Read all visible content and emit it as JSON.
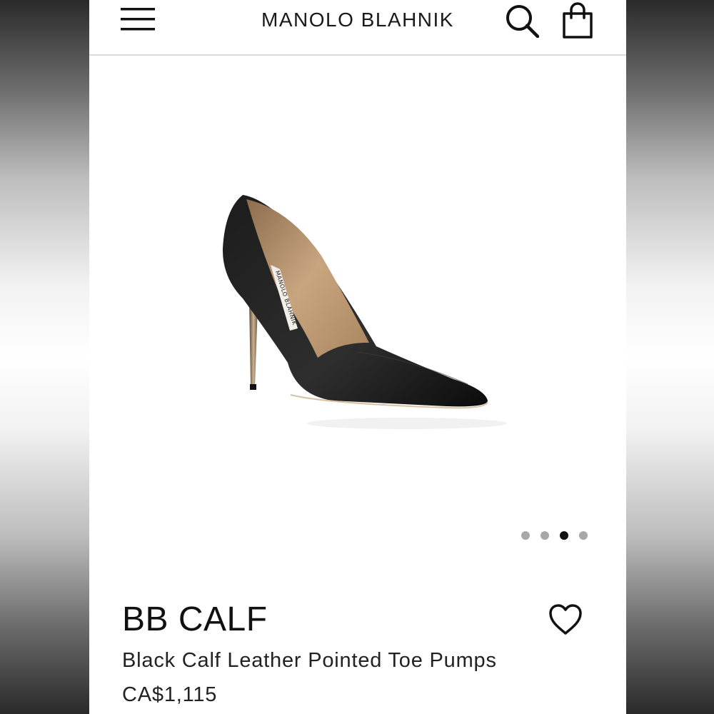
{
  "header": {
    "brand": "MANOLO BLAHNIK",
    "menu_icon": "hamburger-menu-icon",
    "search_icon": "search-icon",
    "bag_icon": "shopping-bag-icon"
  },
  "gallery": {
    "image_subject": "black pointed toe pump",
    "insole_label": "MANOLO BLAHNIK",
    "dots_count": 4,
    "active_dot": 3
  },
  "product": {
    "name": "BB CALF",
    "description": "Black Calf Leather Pointed Toe Pumps",
    "price": "CA$1,115",
    "wishlist_icon": "heart-icon"
  },
  "colors": {
    "text": "#111111",
    "divider": "#dcdcdc",
    "dot_inactive": "#a8a8a8",
    "dot_active": "#111111"
  }
}
